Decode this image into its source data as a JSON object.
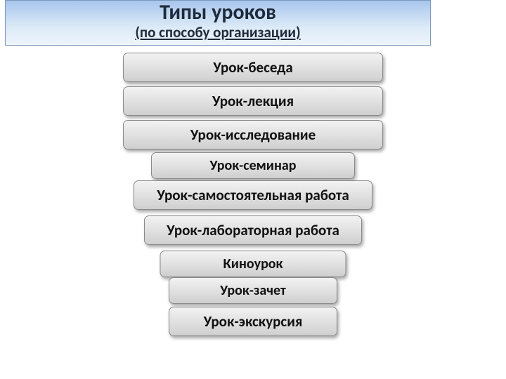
{
  "header": {
    "title": "Типы уроков",
    "subtitle": "(по способу организации)"
  },
  "items": [
    {
      "label": "Урок-беседа"
    },
    {
      "label": "Урок-лекция"
    },
    {
      "label": "Урок-исследование"
    },
    {
      "label": "Урок-семинар"
    },
    {
      "label": "Урок-самостоятельная работа"
    },
    {
      "label": "Урок-лабораторная работа"
    },
    {
      "label": "Киноурок"
    },
    {
      "label": "Урок-зачет"
    },
    {
      "label": "Урок-экскурсия"
    }
  ]
}
